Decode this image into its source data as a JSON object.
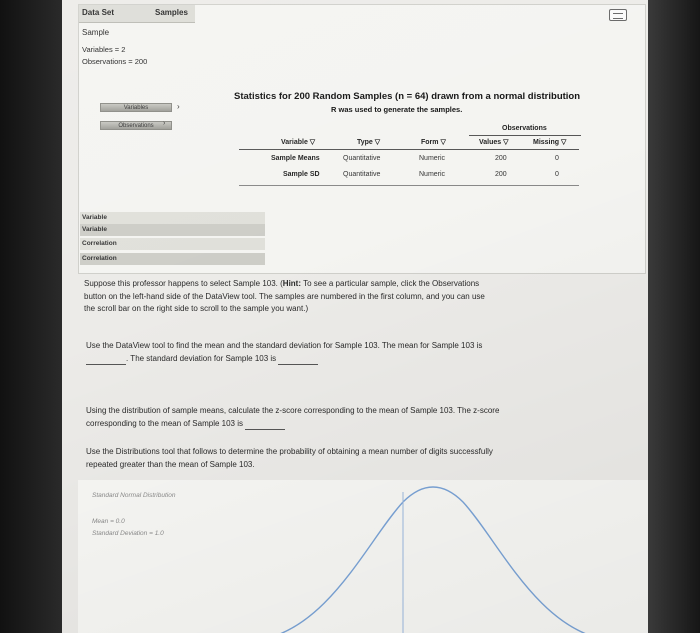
{
  "tabs": {
    "data_set": "Data Set",
    "samples": "Samples"
  },
  "dataset": {
    "name": "Sample",
    "variables": "Variables = 2",
    "observations": "Observations = 200"
  },
  "side_buttons": {
    "variables": "Variables",
    "observations": "Observations"
  },
  "stats": {
    "title": "Statistics for 200 Random Samples (n = 64) drawn from a normal distribution",
    "subtitle": "R was used to generate the samples.",
    "observations_header": "Observations",
    "columns": {
      "variable": "Variable ▽",
      "type": "Type ▽",
      "form": "Form ▽",
      "values": "Values ▽",
      "missing": "Missing ▽"
    },
    "rows": [
      {
        "variable": "Sample Means",
        "type": "Quantitative",
        "form": "Numeric",
        "values": "200",
        "missing": "0"
      },
      {
        "variable": "Sample SD",
        "type": "Quantitative",
        "form": "Numeric",
        "values": "200",
        "missing": "0"
      }
    ]
  },
  "side_list": [
    "Variable",
    "Variable",
    "Correlation",
    "Correlation"
  ],
  "questions": {
    "p1_a": "Suppose this professor happens to select Sample 103. (",
    "p1_hint": "Hint:",
    "p1_b": " To see a particular sample, click the Observations",
    "p1_line2": "button on the left-hand side of the DataView tool. The samples are numbered in the first column, and you can use",
    "p1_line3": "the scroll bar on the right side to scroll to the sample you want.)",
    "p2_line1": "Use the DataView tool to find the mean and the standard deviation for Sample 103. The mean for Sample 103 is",
    "p2_line2": ". The standard deviation for Sample 103 is",
    "p3_line1": "Using the distribution of sample means, calculate the z-score corresponding to the mean of Sample 103. The z-score",
    "p3_line2": "corresponding to the mean of Sample 103 is",
    "p4_line1": "Use the Distributions tool that follows to determine the probability of obtaining a mean number of digits successfully",
    "p4_line2": "repeated greater than the mean of Sample 103."
  },
  "distribution": {
    "title": "Standard Normal Distribution",
    "mean": "Mean = 0.0",
    "sd": "Standard Deviation = 1.0"
  }
}
